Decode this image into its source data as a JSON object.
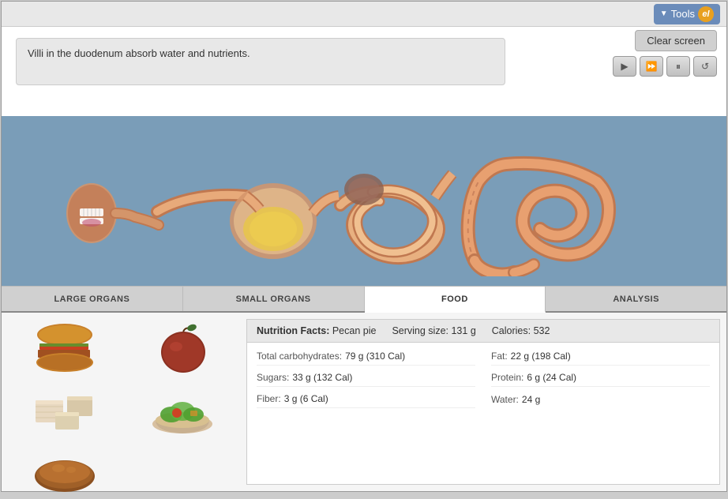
{
  "toolbar": {
    "tools_label": "Tools",
    "tools_logo": "el"
  },
  "info": {
    "text": "Villi in the duodenum absorb water and nutrients."
  },
  "controls": {
    "clear_screen_label": "Clear screen",
    "play_icon": "▶",
    "fast_forward_icon": "▶▶",
    "pause_icon": "⏸",
    "replay_icon": "↺"
  },
  "tabs": [
    {
      "id": "large-organs",
      "label": "LARGE ORGANS",
      "active": false
    },
    {
      "id": "small-organs",
      "label": "SMALL ORGANS",
      "active": false
    },
    {
      "id": "food",
      "label": "FOOD",
      "active": true
    },
    {
      "id": "analysis",
      "label": "ANALYSIS",
      "active": false
    }
  ],
  "nutrition": {
    "title_bold": "Nutrition Facts:",
    "title_item": "Pecan pie",
    "serving_label": "Serving size:",
    "serving_value": "131 g",
    "calories_label": "Calories:",
    "calories_value": "532",
    "rows": [
      {
        "label": "Total carbohydrates:",
        "value": "79 g (310 Cal)",
        "col": 1
      },
      {
        "label": "Fat:",
        "value": "22 g (198 Cal)",
        "col": 2
      },
      {
        "label": "Sugars:",
        "value": "33 g (132 Cal)",
        "col": 1
      },
      {
        "label": "Protein:",
        "value": "6 g (24 Cal)",
        "col": 2
      },
      {
        "label": "Fiber:",
        "value": "3 g (6 Cal)",
        "col": 1
      },
      {
        "label": "Water:",
        "value": "24 g",
        "col": 2
      }
    ]
  }
}
